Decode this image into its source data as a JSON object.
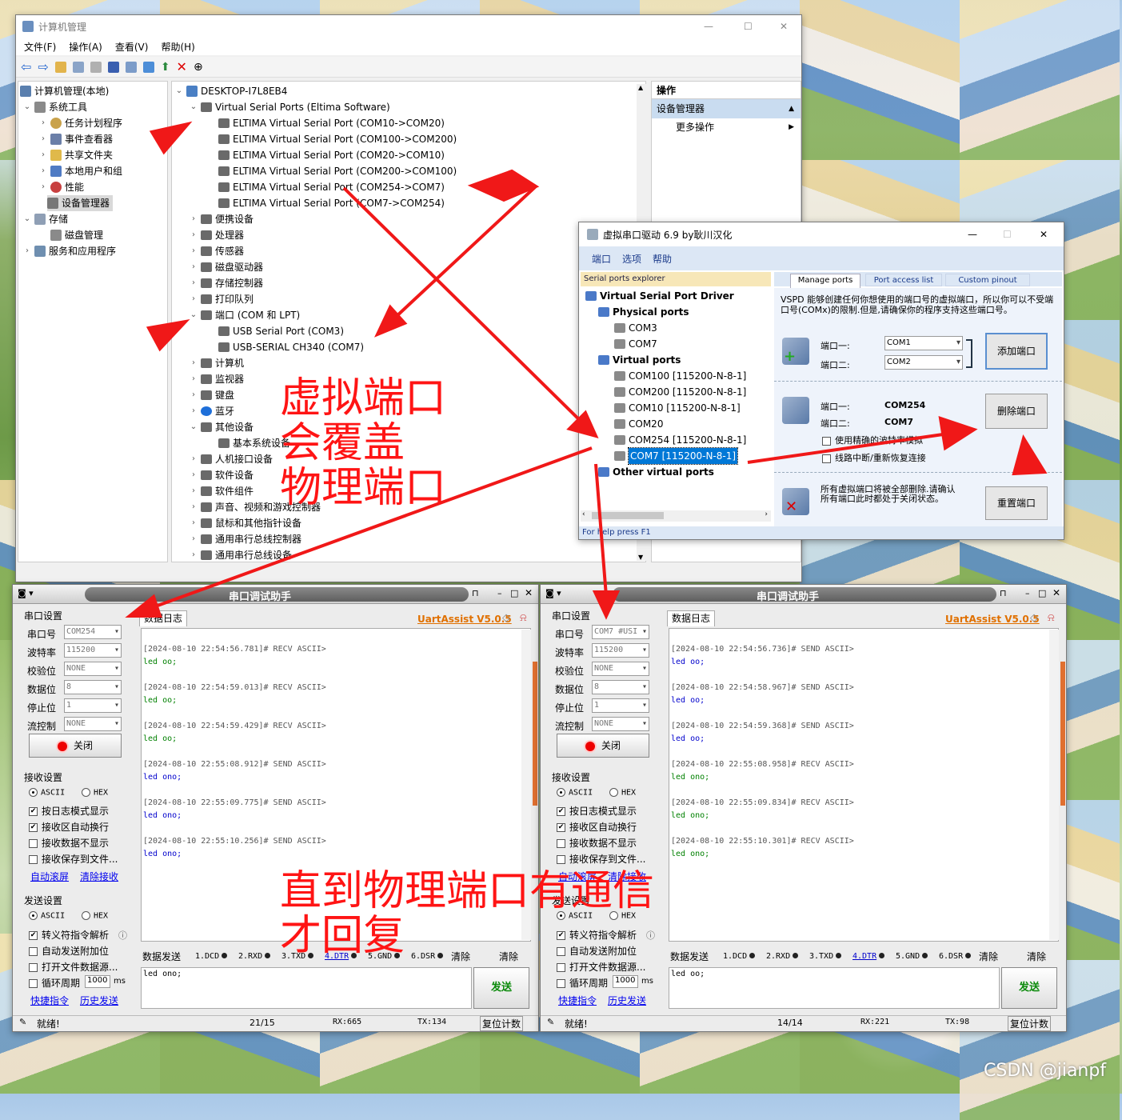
{
  "cm": {
    "title": "计算机管理",
    "menus": [
      "文件(F)",
      "操作(A)",
      "查看(V)",
      "帮助(H)"
    ],
    "left": [
      "计算机管理(本地)",
      "系统工具",
      "任务计划程序",
      "事件查看器",
      "共享文件夹",
      "本地用户和组",
      "性能",
      "设备管理器",
      "存储",
      "磁盘管理",
      "服务和应用程序"
    ],
    "root": "DESKTOP-I7L8EB4",
    "vsp_group": "Virtual Serial Ports (Eltima Software)",
    "vsp": [
      "ELTIMA Virtual Serial Port (COM10->COM20)",
      "ELTIMA Virtual Serial Port (COM100->COM200)",
      "ELTIMA Virtual Serial Port (COM20->COM10)",
      "ELTIMA Virtual Serial Port (COM200->COM100)",
      "ELTIMA Virtual Serial Port (COM254->COM7)",
      "ELTIMA Virtual Serial Port (COM7->COM254)"
    ],
    "cats1": [
      "便携设备",
      "处理器",
      "传感器",
      "磁盘驱动器",
      "存储控制器",
      "打印队列"
    ],
    "ports_group": "端口 (COM 和 LPT)",
    "ports": [
      "USB Serial Port (COM3)",
      "USB-SERIAL CH340 (COM7)"
    ],
    "cats2": [
      "计算机",
      "监视器",
      "键盘",
      "蓝牙",
      "其他设备"
    ],
    "other_child": "基本系统设备",
    "cats3": [
      "人机接口设备",
      "软件设备",
      "软件组件",
      "声音、视频和游戏控制器",
      "鼠标和其他指针设备",
      "通用串行总线控制器",
      "通用串行总线设备"
    ],
    "actions_title": "操作",
    "actions_sel": "设备管理器",
    "actions_more": "更多操作"
  },
  "vspd": {
    "title": "虚拟串口驱动 6.9 by耿川汉化",
    "menus": [
      "端口",
      "选项",
      "帮助"
    ],
    "explorer": "Serial ports explorer",
    "tabs": [
      "Manage ports",
      "Port access list",
      "Custom pinout"
    ],
    "tree_root": "Virtual Serial Port Driver",
    "physical": "Physical ports",
    "phys_items": [
      "COM3",
      "COM7"
    ],
    "virtual": "Virtual ports",
    "virt_items": [
      "COM100 [115200-N-8-1]",
      "COM200 [115200-N-8-1]",
      "COM10 [115200-N-8-1]",
      "COM20",
      "COM254 [115200-N-8-1]",
      "COM7 [115200-N-8-1]"
    ],
    "other_virtual": "Other virtual ports",
    "desc": "VSPD 能够创建任何你想使用的端口号的虚拟端口，所以你可以不受端口号(COMx)的限制.但是,请确保你的程序支持这些端口号。",
    "port1_label": "端口一:",
    "port2_label": "端口二:",
    "port1_val": "COM1",
    "port2_val": "COM2",
    "add_btn": "添加端口",
    "del_p1": "COM254",
    "del_p2": "COM7",
    "del_btn": "删除端口",
    "opt1": "使用精确的波特率模拟",
    "opt2": "线路中断/重新恢复连接",
    "reset_desc": "所有虚拟端口将被全部删除.请确认所有端口此时都处于关闭状态。",
    "reset_btn": "重置端口",
    "status": "For help press F1"
  },
  "uart_common": {
    "title": "串口调试助手",
    "version": "UartAssist V5.0.5",
    "serial_group": "串口设置",
    "labels": [
      "串口号",
      "波特率",
      "校验位",
      "数据位",
      "停止位",
      "流控制"
    ],
    "close": "关闭",
    "recv_group": "接收设置",
    "ascii": "ASCII",
    "hex": "HEX",
    "recv_opts": [
      "按日志模式显示",
      "接收区自动换行",
      "接收数据不显示",
      "接收保存到文件..."
    ],
    "recv_links": [
      "自动滚屏",
      "清除接收"
    ],
    "send_group": "发送设置",
    "send_opts": [
      "转义符指令解析",
      "自动发送附加位",
      "打开文件数据源...",
      "循环周期"
    ],
    "period": "1000",
    "ms": "ms",
    "send_links": [
      "快捷指令",
      "历史发送"
    ],
    "send_tab": "数据发送",
    "pins": [
      "1.DCD",
      "2.RXD",
      "3.TXD",
      "4.DTR",
      "5.GND",
      "6.DSR"
    ],
    "clear1": "清除",
    "clear2": "清除",
    "send_btn": "发送",
    "ready": "就绪!",
    "reset_count": "复位计数"
  },
  "uart1": {
    "tab": "数据日志",
    "values": [
      "COM254",
      "115200",
      "NONE",
      "8",
      "1",
      "NONE"
    ],
    "log": [
      {
        "h": "[2024-08-10 22:54:56.781]# RECV ASCII>",
        "b": "led oo;"
      },
      {
        "h": "[2024-08-10 22:54:59.013]# RECV ASCII>",
        "b": "led oo;"
      },
      {
        "h": "[2024-08-10 22:54:59.429]# RECV ASCII>",
        "b": "led oo;"
      },
      {
        "h": "[2024-08-10 22:55:08.912]# SEND ASCII>",
        "b": "led ono;"
      },
      {
        "h": "[2024-08-10 22:55:09.775]# SEND ASCII>",
        "b": "led ono;"
      },
      {
        "h": "[2024-08-10 22:55:10.256]# SEND ASCII>",
        "b": "led ono;"
      }
    ],
    "send_text": "led ono;",
    "count": "21/15",
    "rx": "RX:665",
    "tx": "TX:134"
  },
  "uart2": {
    "tab": "数据日志",
    "values": [
      "COM7 #USI",
      "115200",
      "NONE",
      "8",
      "1",
      "NONE"
    ],
    "log": [
      {
        "h": "[2024-08-10 22:54:56.736]# SEND ASCII>",
        "b": "led oo;"
      },
      {
        "h": "[2024-08-10 22:54:58.967]# SEND ASCII>",
        "b": "led oo;"
      },
      {
        "h": "[2024-08-10 22:54:59.368]# SEND ASCII>",
        "b": "led oo;"
      },
      {
        "h": "[2024-08-10 22:55:08.958]# RECV ASCII>",
        "b": "led ono;"
      },
      {
        "h": "[2024-08-10 22:55:09.834]# RECV ASCII>",
        "b": "led ono;"
      },
      {
        "h": "[2024-08-10 22:55:10.301]# RECV ASCII>",
        "b": "led ono;"
      }
    ],
    "send_text": "led oo;",
    "count": "14/14",
    "rx": "RX:221",
    "tx": "TX:98"
  },
  "annot": {
    "t1": [
      "虚拟端口",
      "会覆盖",
      "物理端口"
    ],
    "t2": [
      "直到物理端口有通信",
      "才回复"
    ]
  },
  "watermark": "CSDN @jianpf",
  "colors": {
    "arrow": "#f01818",
    "sel": "#0078d7",
    "recv": "#008000",
    "send": "#0000cc"
  }
}
